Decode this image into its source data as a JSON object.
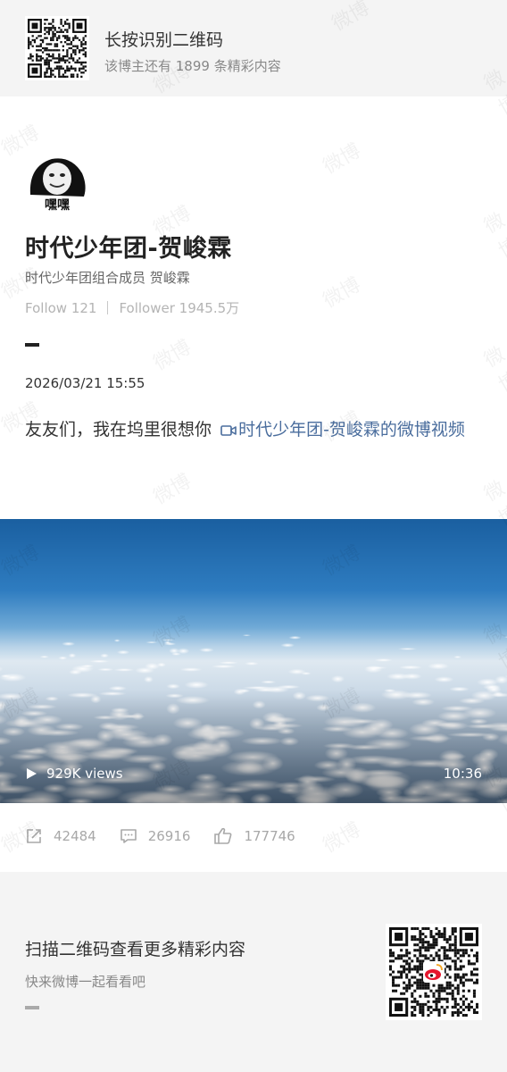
{
  "top": {
    "title": "长按识别二维码",
    "subtitle": "该博主还有 1899 条精彩内容"
  },
  "author": {
    "avatar_text": "嘿嘿",
    "name": "时代少年团-贺峻霖",
    "description": "时代少年团组合成员 贺峻霖",
    "follow_label": "Follow 121",
    "follower_label": "Follower 1945.5万"
  },
  "post": {
    "date": "2026/03/21 15:55",
    "text": "友友们，我在坞里很想你",
    "link_text": "时代少年团-贺峻霖的微博视频"
  },
  "video": {
    "views": "929K views",
    "duration": "10:36"
  },
  "actions": {
    "repost_count": "42484",
    "comment_count": "26916",
    "like_count": "177746"
  },
  "footer": {
    "title": "扫描二维码查看更多精彩内容",
    "subtitle": "快来微博一起看看吧"
  },
  "watermark": "微博",
  "icons": [
    "qr-code-icon",
    "video-camera-icon",
    "play-icon",
    "repost-icon",
    "comment-icon",
    "like-icon",
    "weibo-logo-icon"
  ],
  "colors": {
    "link": "#4a6d9d",
    "muted": "#a8a8a8",
    "page_bg": "#f4f4f4"
  }
}
